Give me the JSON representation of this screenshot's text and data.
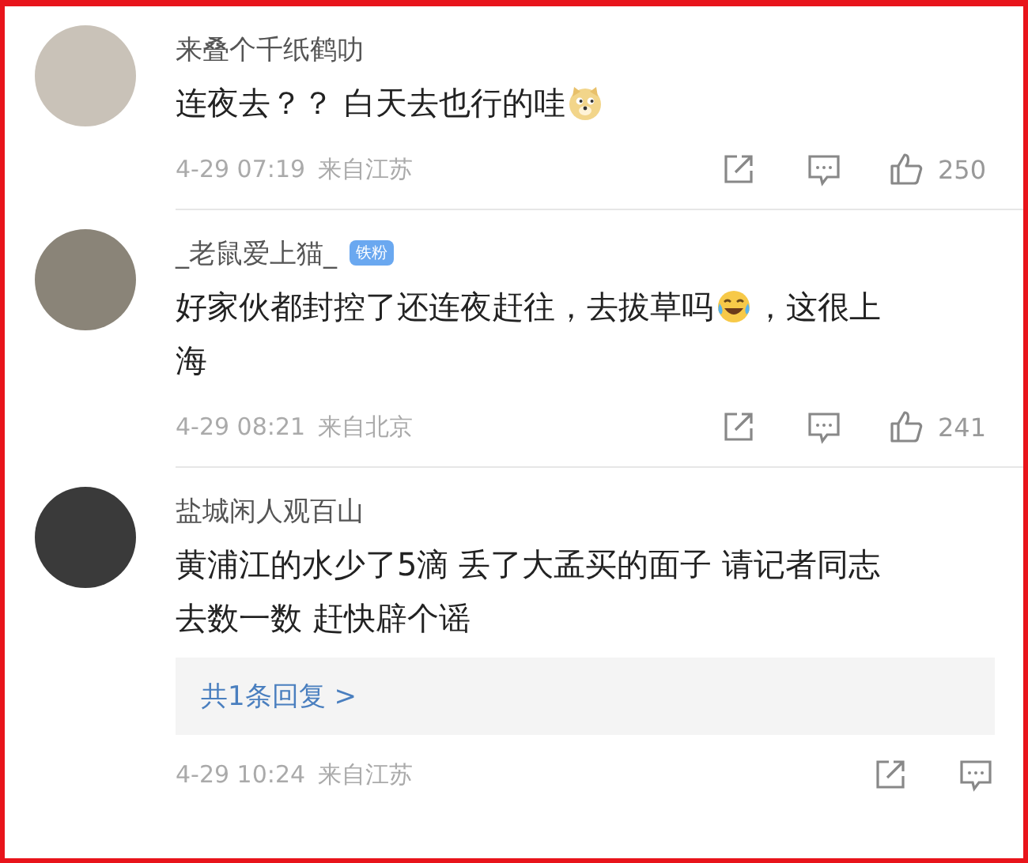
{
  "comments": [
    {
      "name": "来叠个千纸鹤叻",
      "body": [
        {
          "kind": "text",
          "text": "连夜去？？ 白天去也行的哇"
        },
        {
          "kind": "doge"
        }
      ],
      "time": "4-29 07:19",
      "location": "来自江苏",
      "likes": "250"
    },
    {
      "name": "_老鼠爱上猫_",
      "badge": "铁粉",
      "body": [
        {
          "kind": "text",
          "text": "好家伙都封控了还连夜赶往，去拔草吗"
        },
        {
          "kind": "laugh"
        },
        {
          "kind": "text",
          "text": "，这很上海"
        }
      ],
      "time": "4-29 08:21",
      "location": "来自北京",
      "likes": "241"
    },
    {
      "name": "盐城闲人观百山",
      "body": [
        {
          "kind": "text",
          "text": "黄浦江的水少了5滴 丢了大孟买的面子 请记者同志去数一数 赶快辟个谣"
        }
      ],
      "replies": "共1条回复 >",
      "time": "4-29 10:24",
      "location": "来自江苏"
    }
  ]
}
